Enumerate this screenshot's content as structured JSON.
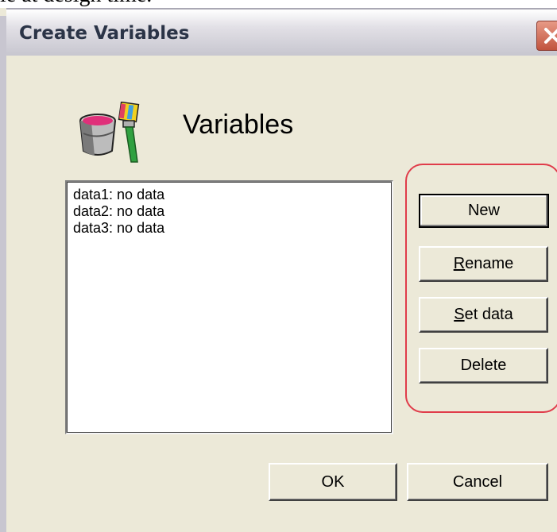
{
  "page_text_above": "le at design time.",
  "window": {
    "title": "Create Variables",
    "close_glyph": "✕"
  },
  "header": {
    "icon": "paint-bucket-brush-icon",
    "title": "Variables"
  },
  "variables_list": {
    "items": [
      {
        "label": "data1: no data"
      },
      {
        "label": "data2: no data"
      },
      {
        "label": "data3: no data"
      }
    ]
  },
  "side_buttons": {
    "new": {
      "label": "New"
    },
    "rename": {
      "accel": "R",
      "rest": "ename"
    },
    "set_data": {
      "accel": "S",
      "rest": "et data"
    },
    "delete": {
      "label": "Delete"
    }
  },
  "footer": {
    "ok": "OK",
    "cancel": "Cancel"
  },
  "colors": {
    "dialog_bg": "#ece9d8",
    "highlight_ring": "#e03c4a",
    "close_button": "#c1533e"
  }
}
